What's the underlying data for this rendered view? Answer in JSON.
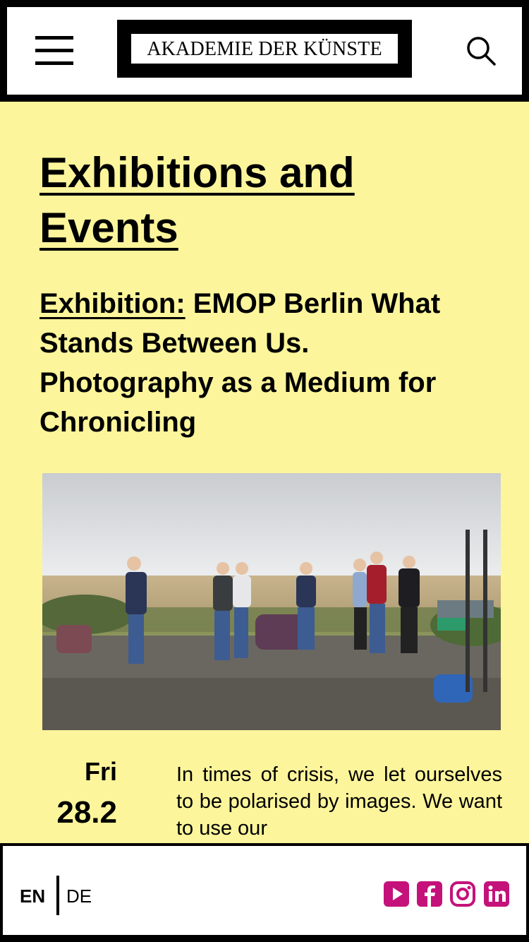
{
  "header": {
    "logo_text": "AKADEMIE DER KÜNSTE",
    "menu_icon": "hamburger-menu-icon",
    "search_icon": "search-icon"
  },
  "main": {
    "page_title": "Exhibitions and Events",
    "event": {
      "kind": "Exhibition:",
      "title": " EMOP Berlin What Stands Between Us. Photography as a Medium for Chronicling",
      "day": "Fri",
      "date": "28.2",
      "teaser": "In times of crisis, we let ourselves to be polarised by images. We want to use our"
    }
  },
  "footer": {
    "lang_en": "EN",
    "lang_de": "DE",
    "social": [
      "youtube-icon",
      "facebook-icon",
      "instagram-icon",
      "linkedin-icon"
    ],
    "accent": "#c4127a"
  },
  "colors": {
    "background": "#fdf59b",
    "frame": "#000000"
  }
}
